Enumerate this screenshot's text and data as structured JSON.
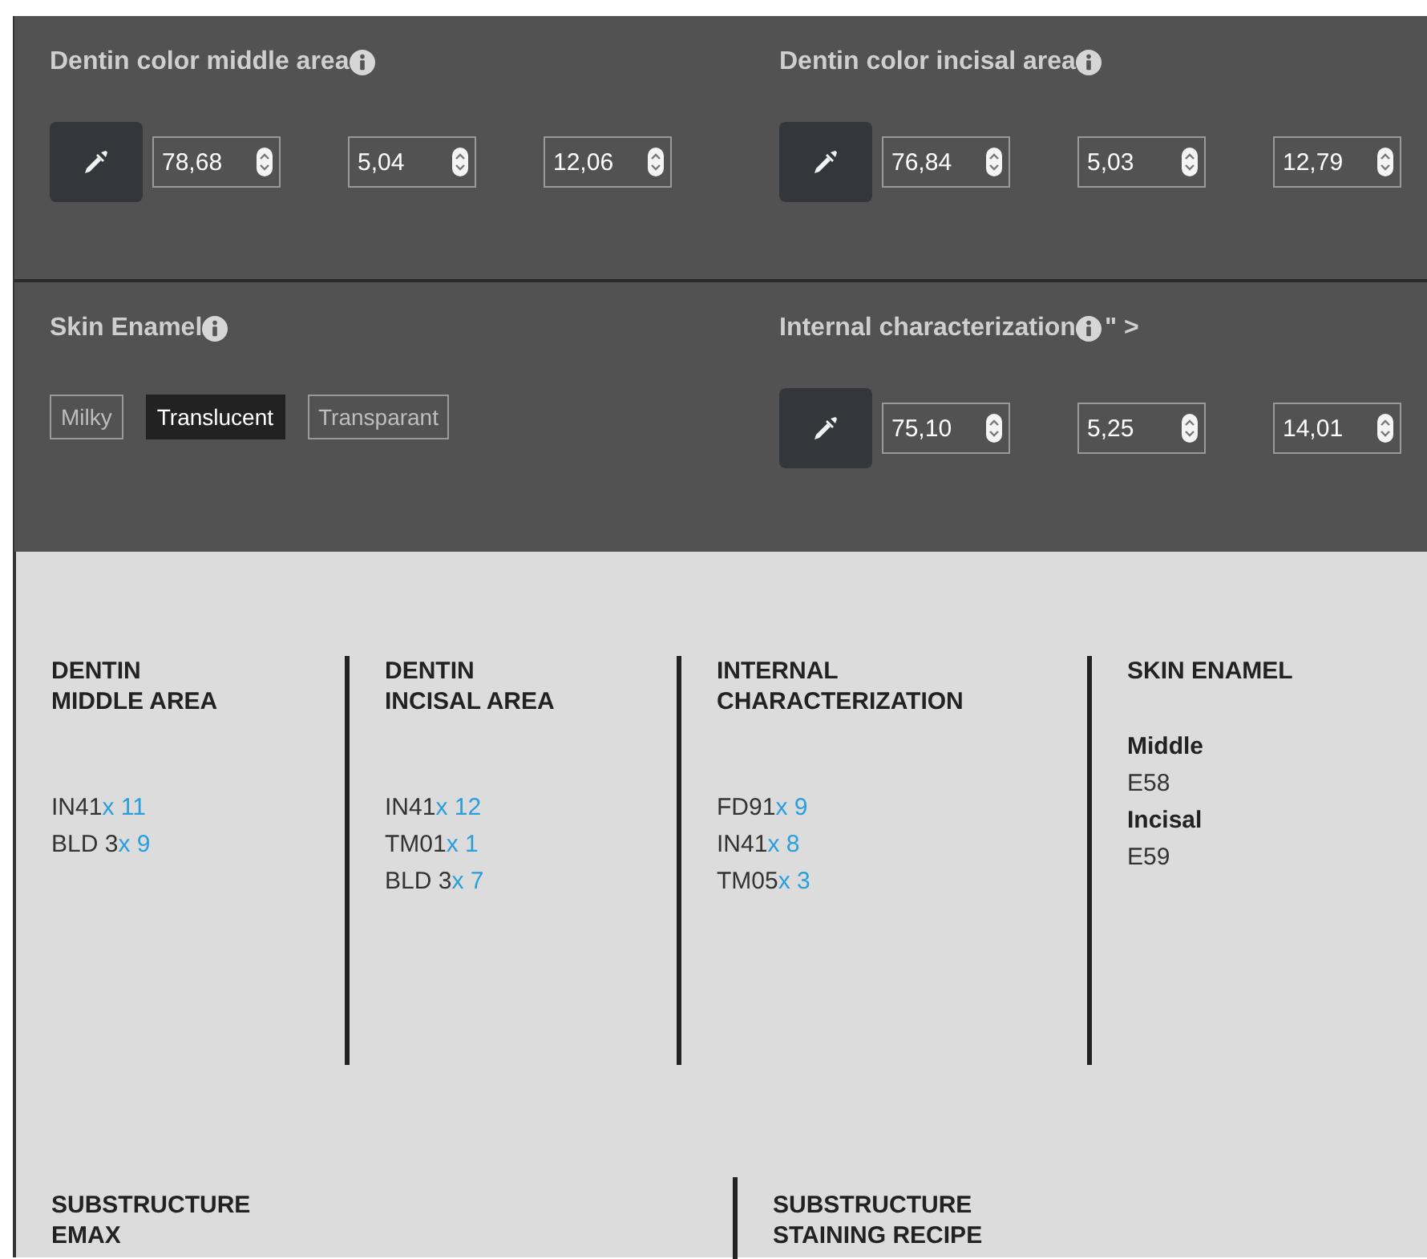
{
  "color_panels": [
    {
      "kind": "color",
      "title": "Dentin color middle area",
      "values": [
        "78,68",
        "5,04",
        "12,06"
      ]
    },
    {
      "kind": "color",
      "title": "Dentin color incisal area",
      "values": [
        "76,84",
        "5,03",
        "12,79"
      ]
    },
    {
      "kind": "options",
      "title": "Skin Enamel",
      "options": [
        {
          "label": "Milky",
          "selected": false
        },
        {
          "label": "Translucent",
          "selected": true
        },
        {
          "label": "Transparant",
          "selected": false
        }
      ]
    },
    {
      "kind": "color",
      "title": "Internal characterization",
      "suffix": "\" >",
      "values": [
        "75,10",
        "5,25",
        "14,01"
      ]
    }
  ],
  "recipe_columns": [
    {
      "heading": "DENTIN\nMIDDLE AREA",
      "items": [
        {
          "kind": "amount",
          "code": "IN41",
          "qty": "x 11"
        },
        {
          "kind": "amount",
          "code": "BLD 3",
          "qty": "x 9"
        }
      ]
    },
    {
      "heading": "DENTIN\nINCISAL AREA",
      "items": [
        {
          "kind": "amount",
          "code": "IN41",
          "qty": "x 12"
        },
        {
          "kind": "amount",
          "code": "TM01",
          "qty": "x 1"
        },
        {
          "kind": "amount",
          "code": "BLD 3",
          "qty": "x 7"
        }
      ]
    },
    {
      "heading": "INTERNAL\nCHARACTERIZATION",
      "items": [
        {
          "kind": "amount",
          "code": "FD91",
          "qty": "x 9"
        },
        {
          "kind": "amount",
          "code": "IN41",
          "qty": "x 8"
        },
        {
          "kind": "amount",
          "code": "TM05",
          "qty": "x 3"
        }
      ]
    },
    {
      "heading": "SKIN ENAMEL",
      "items": [
        {
          "kind": "label",
          "text": "Middle"
        },
        {
          "kind": "value",
          "text": "E58"
        },
        {
          "kind": "label",
          "text": "Incisal"
        },
        {
          "kind": "value",
          "text": "E59"
        }
      ]
    }
  ],
  "substructure": [
    {
      "heading": "SUBSTRUCTURE\nEMAX"
    },
    {
      "heading": "SUBSTRUCTURE\nSTAINING RECIPE"
    }
  ]
}
